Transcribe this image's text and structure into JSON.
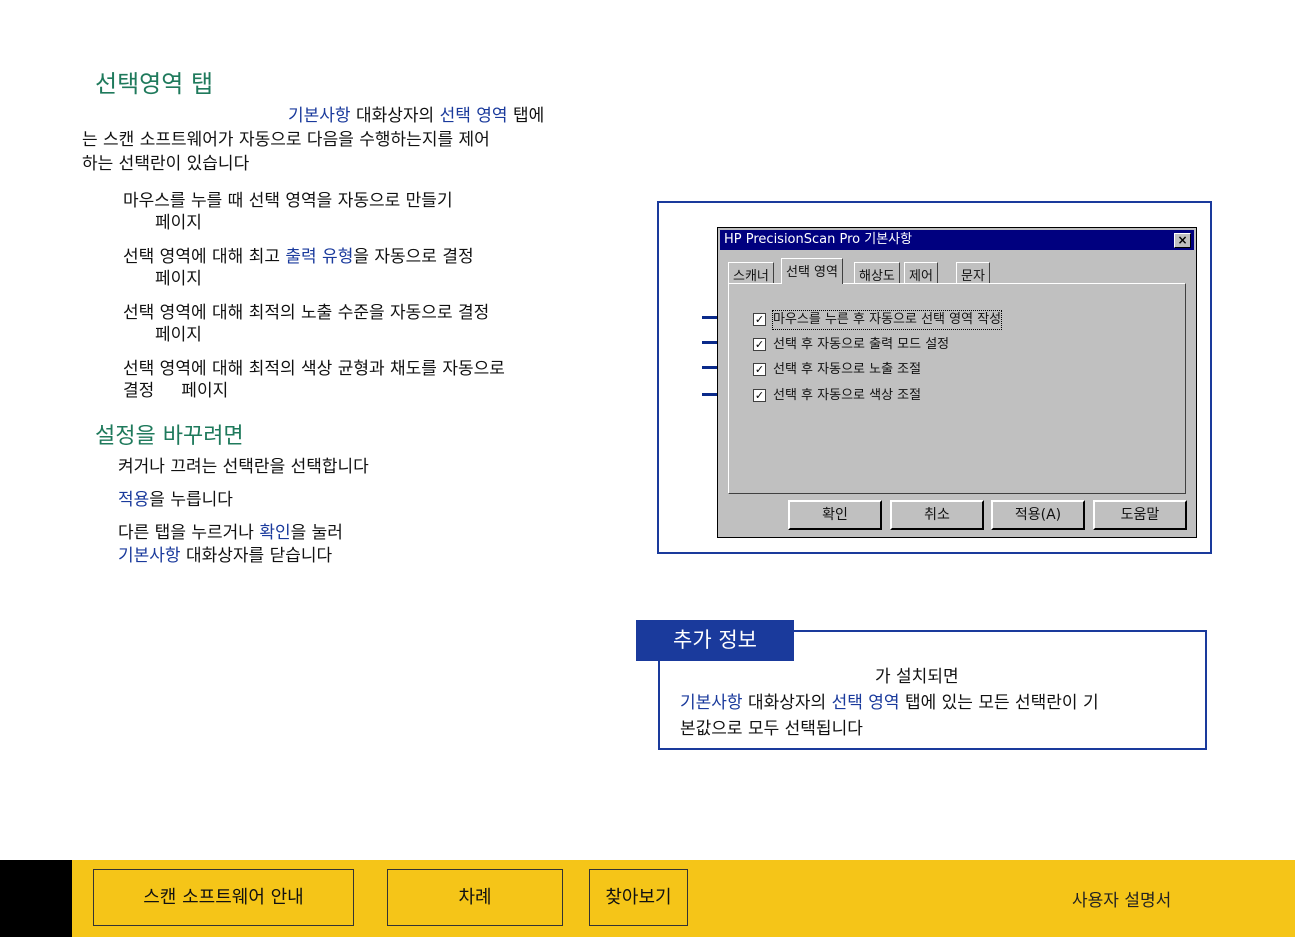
{
  "heading": "선택영역 탭",
  "intro": {
    "line1_highlight1": "기본사항",
    "line1_text1": " 대화상자의 ",
    "line1_highlight2": "선택 영역",
    "line1_text2": " 탭에",
    "line2": "는 스캔 소프트웨어가 자동으로 다음을 수행하는지를 제어",
    "line3": "하는 선택란이 있습니다"
  },
  "bullets": [
    {
      "text_before": "마우스를 누를 때 선택 영역을 자동으로 만들기",
      "highlight": "",
      "text_after": "",
      "page": "페이지"
    },
    {
      "text_before": "선택 영역에 대해 최고 ",
      "highlight": "출력 유형",
      "text_after": "을 자동으로 결정",
      "page": "페이지"
    },
    {
      "text_before": "선택 영역에 대해 최적의 노출 수준을 자동으로 결정",
      "highlight": "",
      "text_after": "",
      "page": "페이지"
    },
    {
      "text_before": "선택 영역에 대해 최적의 색상 균형과 채도를 자동으로",
      "highlight": "",
      "text_after": "",
      "page": "결정     페이지"
    }
  ],
  "subheading": "설정을 바꾸려면",
  "steps": {
    "s1": "켜거나 끄려는 선택란을 선택합니다",
    "s2_highlight": "적용",
    "s2_text": "을 누릅니다",
    "s3_text1": "다른 탭을 누르거나 ",
    "s3_highlight1": "확인",
    "s3_text2": "을 눌러",
    "s3_highlight2": "기본사항",
    "s3_text3": " 대화상자를 닫습니다"
  },
  "dialog": {
    "title": "HP PrecisionScan Pro 기본사항",
    "close_glyph": "×",
    "tabs": [
      "스캐너",
      "선택 영역",
      "해상도",
      "제어",
      "문자"
    ],
    "active_tab": "선택 영역",
    "options": [
      {
        "label": "마우스를 누른 후 자동으로 선택 영역 작성",
        "checked": true
      },
      {
        "label": "선택 후 자동으로 출력 모드 설정",
        "checked": true
      },
      {
        "label": "선택 후 자동으로 노출 조절",
        "checked": true
      },
      {
        "label": "선택 후 자동으로 색상 조절",
        "checked": true
      }
    ],
    "check_glyph": "✓",
    "buttons": [
      "확인",
      "취소",
      "적용(A)",
      "도움말"
    ]
  },
  "info": {
    "tag": "추가 정보",
    "line1": "가 설치되면",
    "line2_highlight1": "기본사항",
    "line2_text1": " 대화상자의 ",
    "line2_highlight2": "선택 영역",
    "line2_text2": " 탭에 있는 모든 선택란이 기",
    "line3": "본값으로 모두 선택됩니다"
  },
  "footer": {
    "nav_buttons": [
      "스캔 소프트웨어 안내",
      "차례",
      "찾아보기"
    ],
    "label": "사용자 설명서"
  },
  "colors": {
    "heading": "#1f7a5c",
    "highlight": "#1a3a9c",
    "footer_bg": "#f5c518",
    "titlebar": "#00007f"
  }
}
